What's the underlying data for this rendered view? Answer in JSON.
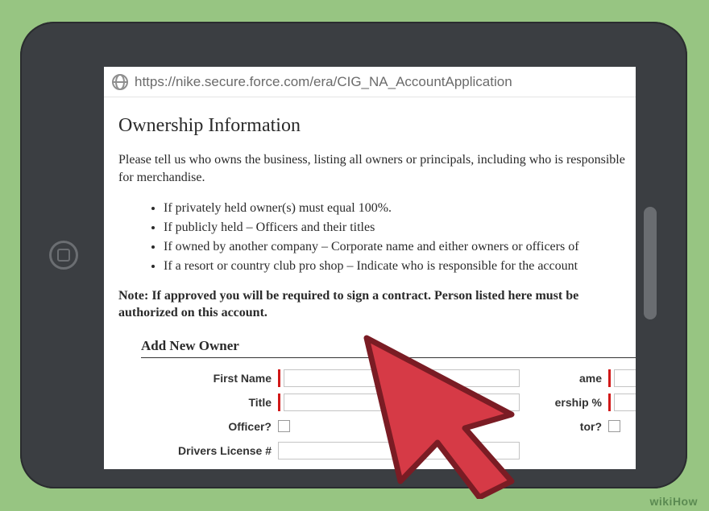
{
  "url": "https://nike.secure.force.com/era/CIG_NA_AccountApplication",
  "heading": "Ownership Information",
  "intro": "Please tell us who owns the business, listing all owners or principals, including who is responsible for merchandise.",
  "bullets": [
    "If privately held owner(s) must equal 100%.",
    "If publicly held – Officers and their titles",
    "If owned by another company – Corporate name and either owners or officers of",
    "If a resort or country club pro shop – Indicate who is responsible for the account"
  ],
  "note": "Note: If approved you will be required to sign a contract. Person listed here must be authorized on this account.",
  "section_title": "Add New Owner",
  "labels": {
    "first_name": "First Name",
    "last_name": "ame",
    "title": "Title",
    "ownership_pct": "ership %",
    "officer": "Officer?",
    "director": "tor?",
    "drivers_license": "Drivers License #"
  },
  "watermark": "wikiHow"
}
